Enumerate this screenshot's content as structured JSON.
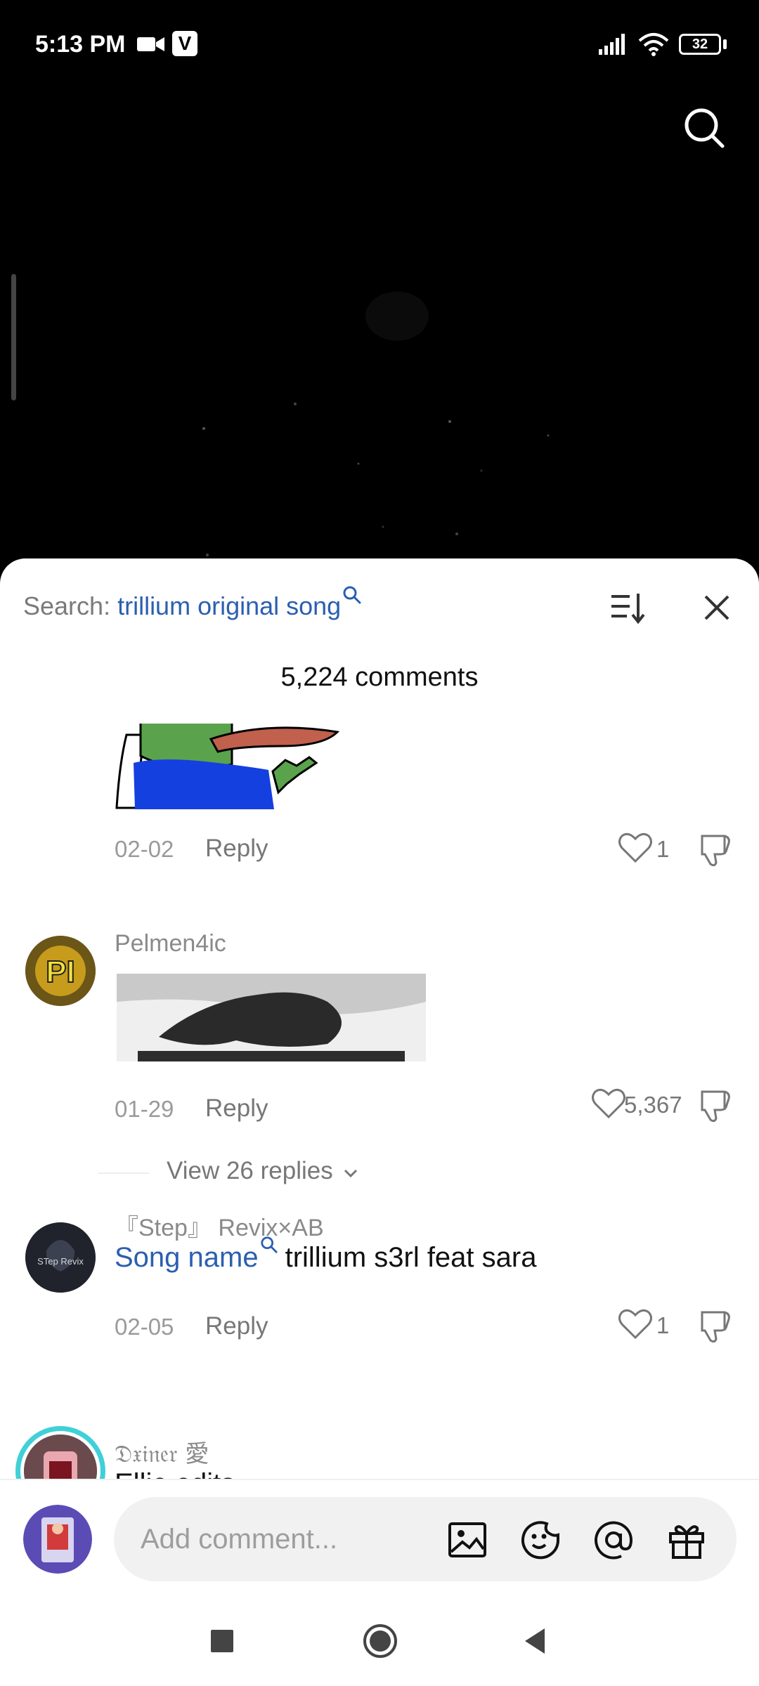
{
  "status_bar": {
    "time": "5:13 PM",
    "battery": "32"
  },
  "sheet": {
    "search_prefix": "Search: ",
    "search_query": "trillium original song",
    "comment_count": "5,224 comments"
  },
  "comments": [
    {
      "date": "02-02",
      "reply_label": "Reply",
      "likes": "1"
    },
    {
      "username": "Pelmen4ic",
      "date": "01-29",
      "reply_label": "Reply",
      "likes": "5,367",
      "view_replies": "View 26 replies"
    },
    {
      "username": "『Step』 Revix×AB",
      "song_label": "Song name",
      "text": "trillium s3rl feat sara",
      "date": "02-05",
      "reply_label": "Reply",
      "likes": "1"
    },
    {
      "username": "𝔇𝔵𝔦𝔫𝔢𝔯 愛",
      "text": "Ellie edits"
    }
  ],
  "comment_input": {
    "placeholder": "Add comment..."
  },
  "colors": {
    "link": "#2b5fb0",
    "text": "#111111",
    "muted": "#8a8a8a",
    "sheet_bg": "#ffffff",
    "video_bg": "#000000"
  },
  "icons": [
    "search-icon",
    "sort-icon",
    "close-icon",
    "heart-icon",
    "dislike-icon",
    "chevron-down-icon",
    "image-icon",
    "emoji-icon",
    "at-icon",
    "gift-icon",
    "nav-square-icon",
    "nav-home-icon",
    "nav-back-icon"
  ]
}
